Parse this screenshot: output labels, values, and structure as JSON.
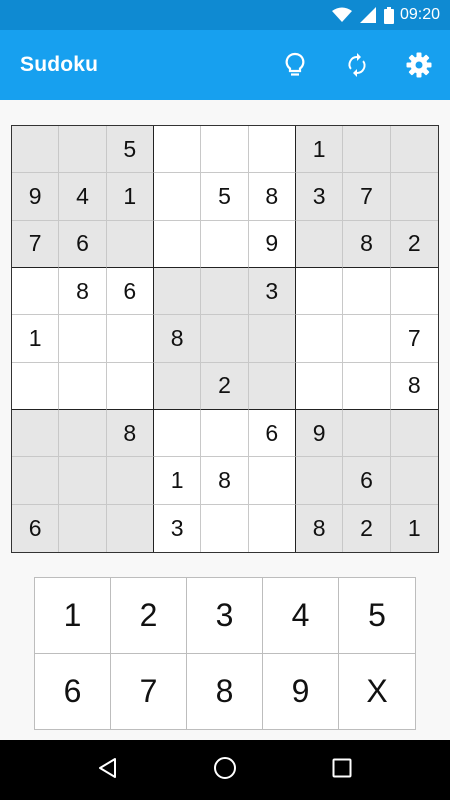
{
  "status_bar": {
    "time": "09:20",
    "icons": [
      "wifi-icon",
      "signal-icon",
      "battery-icon"
    ]
  },
  "app_bar": {
    "title": "Sudoku",
    "actions": [
      "lightbulb-icon",
      "refresh-icon",
      "settings-icon"
    ]
  },
  "board": {
    "cells": [
      [
        "",
        "",
        "5",
        "",
        "",
        "",
        "1",
        "",
        ""
      ],
      [
        "9",
        "4",
        "1",
        "",
        "5",
        "8",
        "3",
        "7",
        ""
      ],
      [
        "7",
        "6",
        "",
        "",
        "",
        "9",
        "",
        "8",
        "2"
      ],
      [
        "",
        "8",
        "6",
        "",
        "",
        "3",
        "",
        "",
        ""
      ],
      [
        "1",
        "",
        "",
        "8",
        "",
        "",
        "",
        "",
        "7"
      ],
      [
        "",
        "",
        "",
        "",
        "2",
        "",
        "",
        "",
        "8"
      ],
      [
        "",
        "",
        "8",
        "",
        "",
        "6",
        "9",
        "",
        ""
      ],
      [
        "",
        "",
        "",
        "1",
        "8",
        "",
        "",
        "6",
        ""
      ],
      [
        "6",
        "",
        "",
        "3",
        "",
        "",
        "8",
        "2",
        "1"
      ]
    ]
  },
  "keypad": {
    "keys": [
      "1",
      "2",
      "3",
      "4",
      "5",
      "6",
      "7",
      "8",
      "9",
      "X"
    ]
  },
  "nav_bar": {
    "buttons": [
      "back-icon",
      "home-icon",
      "recents-icon"
    ]
  },
  "colors": {
    "status_bar": "#0f8ad2",
    "app_bar": "#17a0ef",
    "shaded_box": "#e6e6e6"
  }
}
